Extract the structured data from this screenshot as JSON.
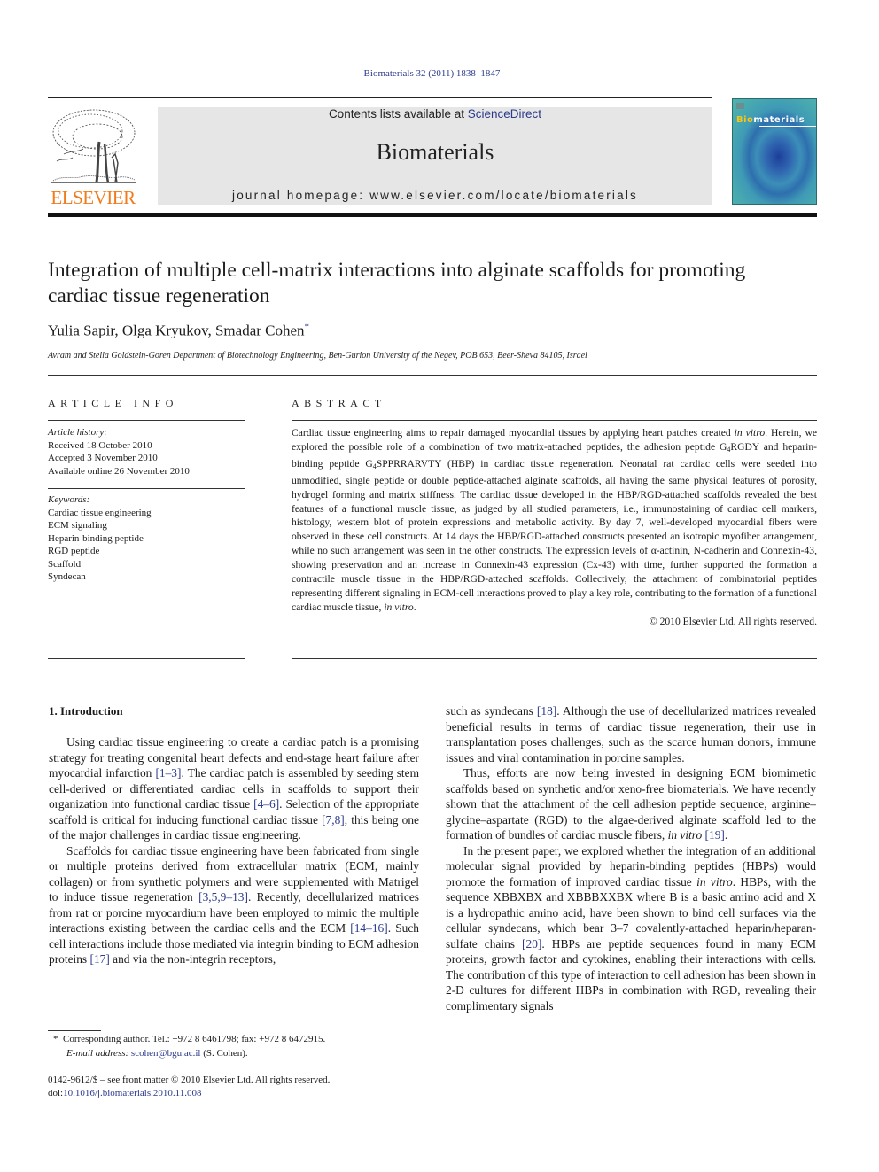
{
  "citation": "Biomaterials 32 (2011) 1838–1847",
  "header": {
    "publisher": "ELSEVIER",
    "contents_prefix": "Contents lists available at ",
    "contents_link": "ScienceDirect",
    "journal_title": "Biomaterials",
    "homepage_prefix": "journal homepage: ",
    "homepage_url": "www.elsevier.com/locate/biomaterials",
    "cover_title_bio": "Bio",
    "cover_title_rest": "materials"
  },
  "article": {
    "title": "Integration of multiple cell-matrix interactions into alginate scaffolds for promoting cardiac tissue regeneration",
    "authors": "Yulia Sapir, Olga Kryukov, Smadar Cohen",
    "author_mark": "*",
    "affiliation": "Avram and Stella Goldstein-Goren Department of Biotechnology Engineering, Ben-Gurion University of the Negev, POB 653, Beer-Sheva 84105, Israel"
  },
  "article_info": {
    "heading": "ARTICLE INFO",
    "history_label": "Article history:",
    "history": [
      "Received 18 October 2010",
      "Accepted 3 November 2010",
      "Available online 26 November 2010"
    ],
    "keywords_label": "Keywords:",
    "keywords": [
      "Cardiac tissue engineering",
      "ECM signaling",
      "Heparin-binding peptide",
      "RGD peptide",
      "Scaffold",
      "Syndecan"
    ]
  },
  "abstract": {
    "heading": "ABSTRACT",
    "p1": "Cardiac tissue engineering aims to repair damaged myocardial tissues by applying heart patches created ",
    "p1_ital": "in vitro",
    "p2": ". Herein, we explored the possible role of a combination of two matrix-attached peptides, the adhesion peptide G",
    "sub1": "4",
    "p3": "RGDY and heparin-binding peptide G",
    "sub2": "4",
    "p4": "SPPRRARVTY (HBP) in cardiac tissue regeneration. Neonatal rat cardiac cells were seeded into unmodified, single peptide or double peptide-attached alginate scaffolds, all having the same physical features of porosity, hydrogel forming and matrix stiffness. The cardiac tissue developed in the HBP/RGD-attached scaffolds revealed the best features of a functional muscle tissue, as judged by all studied parameters, i.e., immunostaining of cardiac cell markers, histology, western blot of protein expressions and metabolic activity. By day 7, well-developed myocardial fibers were observed in these cell constructs. At 14 days the HBP/RGD-attached constructs presented an isotropic myofiber arrangement, while no such arrangement was seen in the other constructs. The expression levels of α-actinin, N-cadherin and Connexin-43, showing preservation and an increase in Connexin-43 expression (Cx-43) with time, further supported the formation a contractile muscle tissue in the HBP/RGD-attached scaffolds. Collectively, the attachment of combinatorial peptides representing different signaling in ECM-cell interactions proved to play a key role, contributing to the formation of a functional cardiac muscle tissue, ",
    "p4_ital": "in vitro",
    "p5": ".",
    "copyright": "© 2010 Elsevier Ltd. All rights reserved."
  },
  "body": {
    "intro_heading": "1.  Introduction",
    "left": {
      "para1_a": "Using cardiac tissue engineering to create a cardiac patch is a promising strategy for treating congenital heart defects and end-stage heart failure after myocardial infarction ",
      "ref1": "[1–3]",
      "para1_b": ". The cardiac patch is assembled by seeding stem cell-derived or differentiated cardiac cells in scaffolds to support their organization into functional cardiac tissue ",
      "ref2": "[4–6]",
      "para1_c": ". Selection of the appropriate scaffold is critical for inducing functional cardiac tissue ",
      "ref3": "[7,8]",
      "para1_d": ", this being one of the major challenges in cardiac tissue engineering.",
      "para2_a": "Scaffolds for cardiac tissue engineering have been fabricated from single or multiple proteins derived from extracellular matrix (ECM, mainly collagen) or from synthetic polymers and were supplemented with Matrigel to induce tissue regeneration ",
      "ref4": "[3,5,9–13]",
      "para2_b": ". Recently, decellularized matrices from rat or porcine myocardium have been employed to mimic the multiple interactions existing between the cardiac cells and the ECM ",
      "ref5": "[14–16]",
      "para2_c": ". Such cell interactions include those mediated via integrin binding to ECM adhesion proteins ",
      "ref6": "[17]",
      "para2_d": " and via the non-integrin receptors,"
    },
    "right": {
      "para1_a": "such as syndecans ",
      "ref1": "[18]",
      "para1_b": ". Although the use of decellularized matrices revealed beneficial results in terms of cardiac tissue regeneration, their use in transplantation poses challenges, such as the scarce human donors, immune issues and viral contamination in porcine samples.",
      "para2_a": "Thus, efforts are now being invested in designing ECM biomimetic scaffolds based on synthetic and/or xeno-free biomaterials. We have recently shown that the attachment of the cell adhesion peptide sequence, arginine–glycine–aspartate (RGD) to the algae-derived alginate scaffold led to the formation of bundles of cardiac muscle fibers, ",
      "para2_ital": "in vitro",
      "ref2": "[19]",
      "para2_b": ".",
      "para3_a": "In the present paper, we explored whether the integration of an additional molecular signal provided by heparin-binding peptides (HBPs) would promote the formation of improved cardiac tissue ",
      "para3_ital": "in vitro",
      "para3_b": ". HBPs, with the sequence XBBXBX and XBBBXXBX where B is a basic amino acid and X is a hydropathic amino acid, have been shown to bind cell surfaces via the cellular syndecans, which bear 3–7 covalently-attached heparin/heparan-sulfate chains ",
      "ref3": "[20]",
      "para3_c": ". HBPs are peptide sequences found in many ECM proteins, growth factor and cytokines, enabling their interactions with cells. The contribution of this type of interaction to cell adhesion has been shown in 2-D cultures for different HBPs in combination with RGD, revealing their complimentary signals"
    }
  },
  "footnote": {
    "mark": "*",
    "text": "Corresponding author. Tel.: +972 8 6461798; fax: +972 8 6472915.",
    "email_label": "E-mail address:",
    "email": "scohen@bgu.ac.il",
    "email_suffix": " (S. Cohen)."
  },
  "front_matter": {
    "issn_line": "0142-9612/$ – see front matter © 2010 Elsevier Ltd. All rights reserved.",
    "doi_prefix": "doi:",
    "doi": "10.1016/j.biomaterials.2010.11.008"
  },
  "colors": {
    "link": "#2b3a8c",
    "elsevier_orange": "#f07c1e",
    "banner_bg": "#e6e6e6"
  }
}
